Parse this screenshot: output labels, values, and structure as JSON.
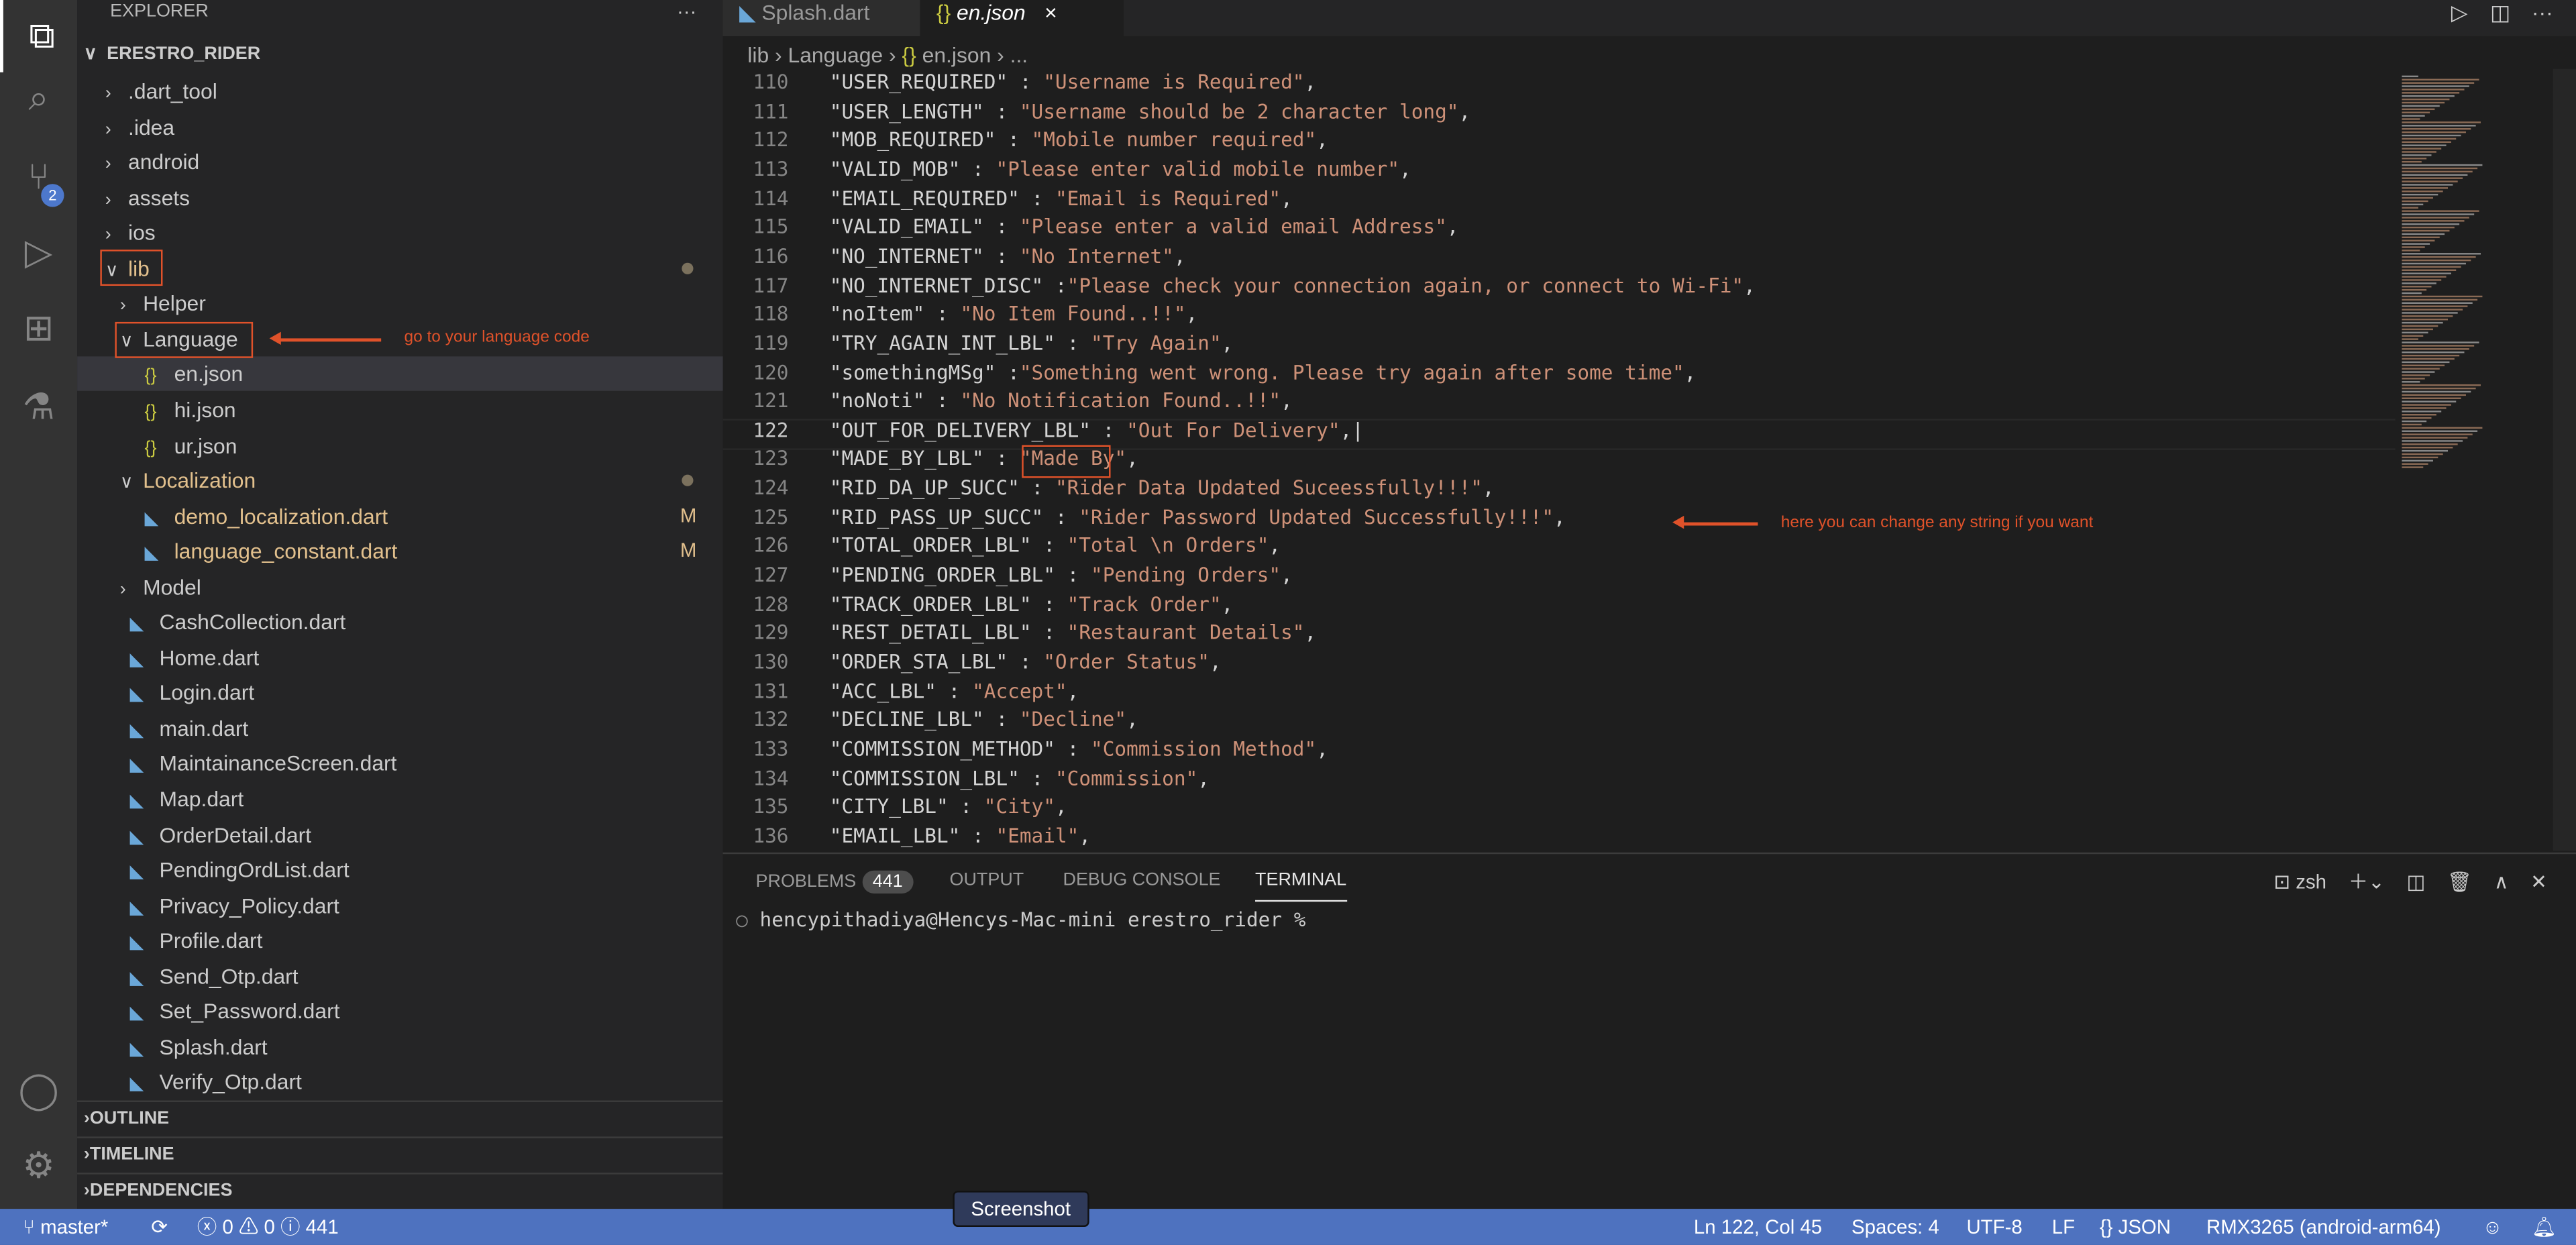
{
  "activity": {
    "scm_badge": "2"
  },
  "sidebar": {
    "title": "EXPLORER",
    "more": "···",
    "project": "ERESTRO_RIDER",
    "tree": [
      {
        "label": ".dart_tool",
        "type": "folder",
        "depth": 1
      },
      {
        "label": ".idea",
        "type": "folder",
        "depth": 1
      },
      {
        "label": "android",
        "type": "folder",
        "depth": 1
      },
      {
        "label": "assets",
        "type": "folder",
        "depth": 1
      },
      {
        "label": "ios",
        "type": "folder",
        "depth": 1
      },
      {
        "label": "lib",
        "type": "folder-open",
        "depth": 1,
        "modified": "dot"
      },
      {
        "label": "Helper",
        "type": "folder",
        "depth": 2
      },
      {
        "label": "Language",
        "type": "folder-open",
        "depth": 2
      },
      {
        "label": "en.json",
        "type": "json",
        "depth": 3,
        "selected": true
      },
      {
        "label": "hi.json",
        "type": "json",
        "depth": 3
      },
      {
        "label": "ur.json",
        "type": "json",
        "depth": 3
      },
      {
        "label": "Localization",
        "type": "folder-open",
        "depth": 2,
        "modified": "dot"
      },
      {
        "label": "demo_localization.dart",
        "type": "dart",
        "depth": 3,
        "modified": "M"
      },
      {
        "label": "language_constant.dart",
        "type": "dart",
        "depth": 3,
        "modified": "M"
      },
      {
        "label": "Model",
        "type": "folder",
        "depth": 2
      },
      {
        "label": "CashCollection.dart",
        "type": "dart",
        "depth": 2
      },
      {
        "label": "Home.dart",
        "type": "dart",
        "depth": 2
      },
      {
        "label": "Login.dart",
        "type": "dart",
        "depth": 2
      },
      {
        "label": "main.dart",
        "type": "dart",
        "depth": 2
      },
      {
        "label": "MaintainanceScreen.dart",
        "type": "dart",
        "depth": 2
      },
      {
        "label": "Map.dart",
        "type": "dart",
        "depth": 2
      },
      {
        "label": "OrderDetail.dart",
        "type": "dart",
        "depth": 2
      },
      {
        "label": "PendingOrdList.dart",
        "type": "dart",
        "depth": 2
      },
      {
        "label": "Privacy_Policy.dart",
        "type": "dart",
        "depth": 2
      },
      {
        "label": "Profile.dart",
        "type": "dart",
        "depth": 2
      },
      {
        "label": "Send_Otp.dart",
        "type": "dart",
        "depth": 2
      },
      {
        "label": "Set_Password.dart",
        "type": "dart",
        "depth": 2
      },
      {
        "label": "Splash.dart",
        "type": "dart",
        "depth": 2
      },
      {
        "label": "Verify_Otp.dart",
        "type": "dart",
        "depth": 2
      }
    ],
    "sections": [
      "OUTLINE",
      "TIMELINE",
      "DEPENDENCIES"
    ]
  },
  "annotations": {
    "language_note": "go to your language code",
    "string_note": "here you can change any string if you want",
    "accent": "#e0522a"
  },
  "tabs": [
    {
      "label": "Splash.dart",
      "icon": "dart-icon"
    },
    {
      "label": "en.json",
      "icon": "json-icon",
      "active": true,
      "close": "×"
    }
  ],
  "breadcrumb": [
    "lib",
    "Language",
    "en.json",
    "..."
  ],
  "editor": {
    "current_line": 122,
    "lines": [
      {
        "n": 110,
        "k": "\"USER_REQUIRED\" : ",
        "v": "\"Username is Required\"",
        "e": ","
      },
      {
        "n": 111,
        "k": "\"USER_LENGTH\" : ",
        "v": "\"Username should be 2 character long\"",
        "e": ","
      },
      {
        "n": 112,
        "k": "\"MOB_REQUIRED\" : ",
        "v": "\"Mobile number required\"",
        "e": ","
      },
      {
        "n": 113,
        "k": "\"VALID_MOB\" : ",
        "v": "\"Please enter valid mobile number\"",
        "e": ","
      },
      {
        "n": 114,
        "k": "\"EMAIL_REQUIRED\" : ",
        "v": "\"Email is Required\"",
        "e": ","
      },
      {
        "n": 115,
        "k": "\"VALID_EMAIL\" : ",
        "v": "\"Please enter a valid email Address\"",
        "e": ","
      },
      {
        "n": 116,
        "k": "\"NO_INTERNET\" : ",
        "v": "\"No Internet\"",
        "e": ","
      },
      {
        "n": 117,
        "k": "\"NO_INTERNET_DISC\" :",
        "v": "\"Please check your connection again, or connect to Wi-Fi\"",
        "e": ","
      },
      {
        "n": 118,
        "k": "\"noItem\" : ",
        "v": "\"No Item Found..!!\"",
        "e": ","
      },
      {
        "n": 119,
        "k": "\"TRY_AGAIN_INT_LBL\" : ",
        "v": "\"Try Again\"",
        "e": ","
      },
      {
        "n": 120,
        "k": "\"somethingMSg\" :",
        "v": "\"Something went wrong. Please try again after some time\"",
        "e": ","
      },
      {
        "n": 121,
        "k": "\"noNoti\" : ",
        "v": "\"No Notification Found..!!\"",
        "e": ","
      },
      {
        "n": 122,
        "k": "\"OUT_FOR_DELIVERY_LBL\" : ",
        "v": "\"Out For Delivery\"",
        "e": ",|"
      },
      {
        "n": 123,
        "k": "\"MADE_BY_LBL\" : ",
        "v": "\"Made By\"",
        "e": ","
      },
      {
        "n": 124,
        "k": "\"RID_DA_UP_SUCC\" : ",
        "v": "\"Rider Data Updated Suceessfully!!!\"",
        "e": ","
      },
      {
        "n": 125,
        "k": "\"RID_PASS_UP_SUCC\" : ",
        "v": "\"Rider Password Updated Successfully!!!\"",
        "e": ","
      },
      {
        "n": 126,
        "k": "\"TOTAL_ORDER_LBL\" : ",
        "v": "\"Total \\n Orders\"",
        "e": ","
      },
      {
        "n": 127,
        "k": "\"PENDING_ORDER_LBL\" : ",
        "v": "\"Pending Orders\"",
        "e": ","
      },
      {
        "n": 128,
        "k": "\"TRACK_ORDER_LBL\" : ",
        "v": "\"Track Order\"",
        "e": ","
      },
      {
        "n": 129,
        "k": "\"REST_DETAIL_LBL\" : ",
        "v": "\"Restaurant Details\"",
        "e": ","
      },
      {
        "n": 130,
        "k": "\"ORDER_STA_LBL\" : ",
        "v": "\"Order Status\"",
        "e": ","
      },
      {
        "n": 131,
        "k": "\"ACC_LBL\" : ",
        "v": "\"Accept\"",
        "e": ","
      },
      {
        "n": 132,
        "k": "\"DECLINE_LBL\" : ",
        "v": "\"Decline\"",
        "e": ","
      },
      {
        "n": 133,
        "k": "\"COMMISSION_METHOD\" : ",
        "v": "\"Commission Method\"",
        "e": ","
      },
      {
        "n": 134,
        "k": "\"COMMISSION_LBL\" : ",
        "v": "\"Commission\"",
        "e": ","
      },
      {
        "n": 135,
        "k": "\"CITY_LBL\" : ",
        "v": "\"City\"",
        "e": ","
      },
      {
        "n": 136,
        "k": "\"EMAIL_LBL\" : ",
        "v": "\"Email\"",
        "e": ","
      }
    ]
  },
  "panel": {
    "tabs": [
      {
        "label": "PROBLEMS",
        "badge": "441"
      },
      {
        "label": "OUTPUT"
      },
      {
        "label": "DEBUG CONSOLE"
      },
      {
        "label": "TERMINAL",
        "active": true
      }
    ],
    "shell": "zsh",
    "terminal_prompt": "hencypithadiya@Hencys-Mac-mini erestro_rider %"
  },
  "status": {
    "branch": "master*",
    "errors": "0",
    "warnings": "0",
    "info": "441",
    "position": "Ln 122, Col 45",
    "spaces": "Spaces: 4",
    "encoding": "UTF-8",
    "eol": "LF",
    "language": "JSON",
    "device": "RMX3265 (android-arm64)",
    "color": "#4e72bf"
  },
  "tooltip": "Screenshot"
}
